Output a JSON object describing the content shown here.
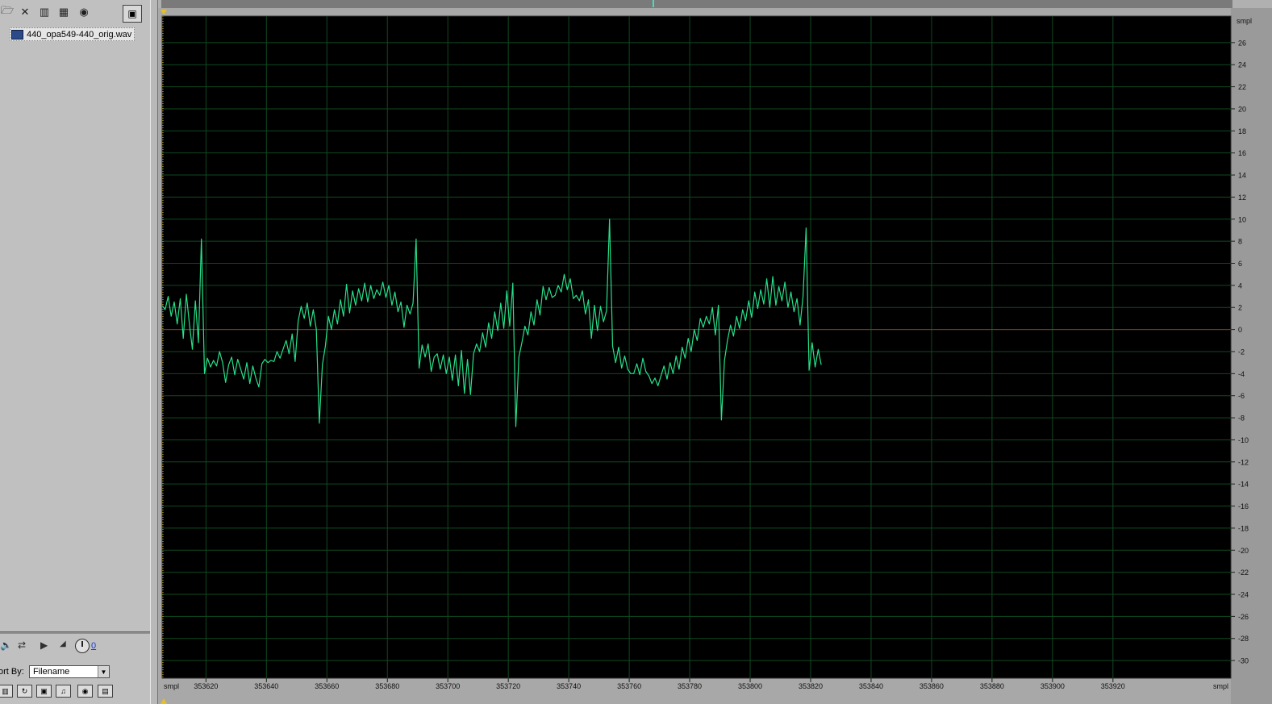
{
  "files_panel": {
    "toolbar_icons": [
      "open-file-icon",
      "close-file-icon",
      "insert-icon",
      "insert-multitrack-icon",
      "edit-file-icon"
    ],
    "view_toggle_icon": "show-options-icon",
    "file_name": "440_opa549-440_orig.wav",
    "volume_value": "0",
    "sort_label": "ort By:",
    "sort_value": "Filename",
    "bottom_icons": [
      "audio-filter-icon",
      "loop-filter-icon",
      "video-filter-icon",
      "midi-filter-icon",
      "full-path-icon",
      "cue-filter-icon"
    ]
  },
  "colors": {
    "waveform": "#27e08a",
    "grid": "#0f4a20",
    "zero_line": "#c01818",
    "background": "#000000",
    "selection_marker": "#e8c020"
  },
  "chart_data": {
    "type": "line",
    "title": "",
    "xlabel": "smpl",
    "ylabel": "smpl",
    "xlim": [
      353605.5,
      353959
    ],
    "ylim": [
      -31.6,
      28.4
    ],
    "x_tick_labels": [
      "smpl",
      "353620",
      "353640",
      "353660",
      "353680",
      "353700",
      "353720",
      "353740",
      "353760",
      "353780",
      "353800",
      "353820",
      "353840",
      "353860",
      "353880",
      "353900",
      "353920",
      "smpl"
    ],
    "x_ticks": [
      353620,
      353640,
      353660,
      353680,
      353700,
      353720,
      353740,
      353760,
      353780,
      353800,
      353820,
      353840,
      353860,
      353880,
      353900,
      353920
    ],
    "y_ticks": [
      26,
      24,
      22,
      20,
      18,
      16,
      14,
      12,
      10,
      8,
      6,
      4,
      2,
      0,
      -2,
      -4,
      -6,
      -8,
      -10,
      -12,
      -14,
      -16,
      -18,
      -20,
      -22,
      -24,
      -26,
      -28,
      -30
    ],
    "y_unit_label": "smpl",
    "grid": true,
    "zero_line": 0,
    "series": [
      {
        "values": [
          [
            353605.5,
            2.2
          ],
          [
            353606.5,
            1.8
          ],
          [
            353607.5,
            3.0
          ],
          [
            353608.5,
            1.2
          ],
          [
            353609.5,
            2.5
          ],
          [
            353610.5,
            0.5
          ],
          [
            353611.5,
            2.8
          ],
          [
            353612.5,
            -0.8
          ],
          [
            353613.5,
            3.2
          ],
          [
            353614.5,
            0.6
          ],
          [
            353615.5,
            -1.8
          ],
          [
            353616.5,
            2.6
          ],
          [
            353617.5,
            -1.2
          ],
          [
            353618.5,
            8.2
          ],
          [
            353619.5,
            -4.0
          ],
          [
            353620.5,
            -2.6
          ],
          [
            353621.5,
            -3.4
          ],
          [
            353622.5,
            -2.8
          ],
          [
            353623.5,
            -3.3
          ],
          [
            353624.5,
            -2.0
          ],
          [
            353625.5,
            -3.0
          ],
          [
            353626.5,
            -4.8
          ],
          [
            353627.5,
            -3.2
          ],
          [
            353628.5,
            -2.5
          ],
          [
            353629.5,
            -4.1
          ],
          [
            353630.5,
            -2.7
          ],
          [
            353631.5,
            -3.6
          ],
          [
            353632.5,
            -4.5
          ],
          [
            353633.5,
            -3.0
          ],
          [
            353634.5,
            -4.9
          ],
          [
            353635.5,
            -3.3
          ],
          [
            353636.5,
            -4.4
          ],
          [
            353637.5,
            -5.2
          ],
          [
            353638.5,
            -3.1
          ],
          [
            353639.5,
            -2.7
          ],
          [
            353640.5,
            -3.0
          ],
          [
            353641.5,
            -2.8
          ],
          [
            353642.5,
            -2.9
          ],
          [
            353643.5,
            -2.0
          ],
          [
            353644.5,
            -2.6
          ],
          [
            353645.5,
            -1.8
          ],
          [
            353646.5,
            -1.0
          ],
          [
            353647.5,
            -2.2
          ],
          [
            353648.5,
            -0.4
          ],
          [
            353649.5,
            -2.9
          ],
          [
            353650.5,
            0.8
          ],
          [
            353651.5,
            2.1
          ],
          [
            353652.5,
            1.0
          ],
          [
            353653.5,
            2.4
          ],
          [
            353654.5,
            0.3
          ],
          [
            353655.5,
            1.8
          ],
          [
            353656.5,
            0.0
          ],
          [
            353657.5,
            -8.5
          ],
          [
            353658.5,
            -3.2
          ],
          [
            353659.5,
            -1.5
          ],
          [
            353660.5,
            1.2
          ],
          [
            353661.5,
            0.0
          ],
          [
            353662.5,
            1.8
          ],
          [
            353663.5,
            0.5
          ],
          [
            353664.5,
            2.7
          ],
          [
            353665.5,
            1.2
          ],
          [
            353666.5,
            4.1
          ],
          [
            353667.5,
            1.5
          ],
          [
            353668.5,
            3.5
          ],
          [
            353669.5,
            2.2
          ],
          [
            353670.5,
            3.7
          ],
          [
            353671.5,
            2.6
          ],
          [
            353672.5,
            4.2
          ],
          [
            353673.5,
            2.5
          ],
          [
            353674.5,
            4.0
          ],
          [
            353675.5,
            2.8
          ],
          [
            353676.5,
            3.6
          ],
          [
            353677.5,
            3.1
          ],
          [
            353678.5,
            4.3
          ],
          [
            353679.5,
            2.9
          ],
          [
            353680.5,
            4.0
          ],
          [
            353681.5,
            2.2
          ],
          [
            353682.5,
            3.4
          ],
          [
            353683.5,
            1.6
          ],
          [
            353684.5,
            2.5
          ],
          [
            353685.5,
            0.2
          ],
          [
            353686.5,
            2.2
          ],
          [
            353687.5,
            1.4
          ],
          [
            353688.5,
            2.4
          ],
          [
            353689.5,
            8.2
          ],
          [
            353690.5,
            -3.5
          ],
          [
            353691.5,
            -1.4
          ],
          [
            353692.5,
            -2.5
          ],
          [
            353693.5,
            -1.3
          ],
          [
            353694.5,
            -3.8
          ],
          [
            353695.5,
            -2.5
          ],
          [
            353696.5,
            -2.2
          ],
          [
            353697.5,
            -3.6
          ],
          [
            353698.5,
            -2.3
          ],
          [
            353699.5,
            -4.0
          ],
          [
            353700.5,
            -2.5
          ],
          [
            353701.5,
            -4.6
          ],
          [
            353702.5,
            -2.3
          ],
          [
            353703.5,
            -5.1
          ],
          [
            353704.5,
            -1.9
          ],
          [
            353705.5,
            -5.8
          ],
          [
            353706.5,
            -2.7
          ],
          [
            353707.5,
            -5.9
          ],
          [
            353708.5,
            -2.2
          ],
          [
            353709.5,
            -1.3
          ],
          [
            353710.5,
            -2.0
          ],
          [
            353711.5,
            -0.3
          ],
          [
            353712.5,
            -1.6
          ],
          [
            353713.5,
            0.6
          ],
          [
            353714.5,
            -0.8
          ],
          [
            353715.5,
            1.6
          ],
          [
            353716.5,
            -0.1
          ],
          [
            353717.5,
            2.4
          ],
          [
            353718.5,
            0.1
          ],
          [
            353719.5,
            3.5
          ],
          [
            353720.5,
            0.3
          ],
          [
            353721.5,
            4.2
          ],
          [
            353722.5,
            -8.8
          ],
          [
            353723.5,
            -2.5
          ],
          [
            353724.5,
            -1.2
          ],
          [
            353725.5,
            0.3
          ],
          [
            353726.5,
            -0.5
          ],
          [
            353727.5,
            1.6
          ],
          [
            353728.5,
            0.4
          ],
          [
            353729.5,
            2.7
          ],
          [
            353730.5,
            1.3
          ],
          [
            353731.5,
            3.9
          ],
          [
            353732.5,
            2.7
          ],
          [
            353733.5,
            3.8
          ],
          [
            353734.5,
            2.9
          ],
          [
            353735.5,
            3.1
          ],
          [
            353736.5,
            4.0
          ],
          [
            353737.5,
            3.4
          ],
          [
            353738.5,
            5.0
          ],
          [
            353739.5,
            3.6
          ],
          [
            353740.5,
            4.6
          ],
          [
            353741.5,
            2.8
          ],
          [
            353742.5,
            3.1
          ],
          [
            353743.5,
            2.6
          ],
          [
            353744.5,
            3.5
          ],
          [
            353745.5,
            1.4
          ],
          [
            353746.5,
            2.7
          ],
          [
            353747.5,
            -0.8
          ],
          [
            353748.5,
            2.2
          ],
          [
            353749.5,
            -0.1
          ],
          [
            353750.5,
            2.1
          ],
          [
            353751.5,
            0.7
          ],
          [
            353752.5,
            1.7
          ],
          [
            353753.5,
            10.0
          ],
          [
            353754.5,
            -1.5
          ],
          [
            353755.5,
            -3.0
          ],
          [
            353756.5,
            -1.6
          ],
          [
            353757.5,
            -3.5
          ],
          [
            353758.5,
            -2.4
          ],
          [
            353759.5,
            -3.6
          ],
          [
            353760.5,
            -4.0
          ],
          [
            353761.5,
            -4.0
          ],
          [
            353762.5,
            -3.1
          ],
          [
            353763.5,
            -4.1
          ],
          [
            353764.5,
            -2.6
          ],
          [
            353765.5,
            -3.8
          ],
          [
            353766.5,
            -4.2
          ],
          [
            353767.5,
            -4.9
          ],
          [
            353768.5,
            -4.4
          ],
          [
            353769.5,
            -5.1
          ],
          [
            353770.5,
            -4.2
          ],
          [
            353771.5,
            -3.3
          ],
          [
            353772.5,
            -4.5
          ],
          [
            353773.5,
            -3.0
          ],
          [
            353774.5,
            -4.0
          ],
          [
            353775.5,
            -2.4
          ],
          [
            353776.5,
            -3.6
          ],
          [
            353777.5,
            -1.6
          ],
          [
            353778.5,
            -2.6
          ],
          [
            353779.5,
            -0.8
          ],
          [
            353780.5,
            -2.0
          ],
          [
            353781.5,
            0.0
          ],
          [
            353782.5,
            -1.0
          ],
          [
            353783.5,
            1.0
          ],
          [
            353784.5,
            0.2
          ],
          [
            353785.5,
            1.2
          ],
          [
            353786.5,
            0.5
          ],
          [
            353787.5,
            2.0
          ],
          [
            353788.5,
            -0.5
          ],
          [
            353789.5,
            2.2
          ],
          [
            353790.5,
            -8.2
          ],
          [
            353791.5,
            -2.8
          ],
          [
            353792.5,
            -1.0
          ],
          [
            353793.5,
            0.4
          ],
          [
            353794.5,
            -0.6
          ],
          [
            353795.5,
            1.2
          ],
          [
            353796.5,
            0.1
          ],
          [
            353797.5,
            1.8
          ],
          [
            353798.5,
            0.8
          ],
          [
            353799.5,
            2.6
          ],
          [
            353800.5,
            1.1
          ],
          [
            353801.5,
            3.4
          ],
          [
            353802.5,
            1.9
          ],
          [
            353803.5,
            3.6
          ],
          [
            353804.5,
            2.3
          ],
          [
            353805.5,
            4.6
          ],
          [
            353806.5,
            2.0
          ],
          [
            353807.5,
            4.8
          ],
          [
            353808.5,
            2.2
          ],
          [
            353809.5,
            3.9
          ],
          [
            353810.5,
            2.6
          ],
          [
            353811.5,
            4.3
          ],
          [
            353812.5,
            2.0
          ],
          [
            353813.5,
            3.4
          ],
          [
            353814.5,
            1.6
          ],
          [
            353815.5,
            2.8
          ],
          [
            353816.5,
            0.4
          ],
          [
            353817.5,
            3.0
          ],
          [
            353818.5,
            9.2
          ],
          [
            353819.5,
            -3.7
          ],
          [
            353820.5,
            -1.2
          ],
          [
            353821.5,
            -3.4
          ],
          [
            353822.5,
            -1.8
          ],
          [
            353823.5,
            -3.2
          ]
        ]
      }
    ]
  }
}
